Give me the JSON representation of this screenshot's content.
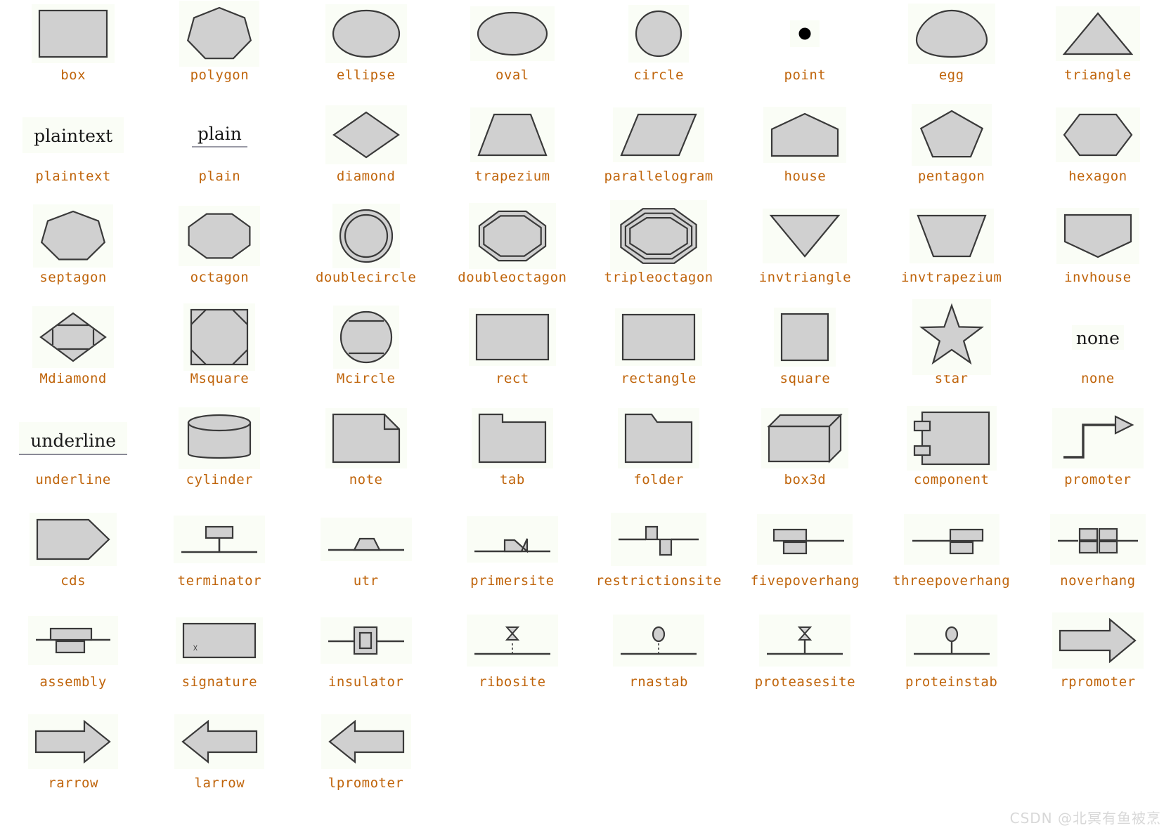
{
  "page": {
    "title": "Graphviz node shapes gallery",
    "watermark": "CSDN @北冥有鱼被烹",
    "label_color": "#c0650c",
    "shape_fill": "#d0d0d0",
    "shape_stroke": "#3a3a3a",
    "cell_background": "#fafdf6",
    "page_background": "#ffffff"
  },
  "shapes": [
    {
      "label": "box",
      "kind": "box"
    },
    {
      "label": "polygon",
      "kind": "polygon"
    },
    {
      "label": "ellipse",
      "kind": "ellipse"
    },
    {
      "label": "oval",
      "kind": "oval"
    },
    {
      "label": "circle",
      "kind": "circle"
    },
    {
      "label": "point",
      "kind": "point"
    },
    {
      "label": "egg",
      "kind": "egg"
    },
    {
      "label": "triangle",
      "kind": "triangle"
    },
    {
      "label": "plaintext",
      "kind": "text",
      "text": "plaintext"
    },
    {
      "label": "plain",
      "kind": "text-ul",
      "text": "plain"
    },
    {
      "label": "diamond",
      "kind": "diamond"
    },
    {
      "label": "trapezium",
      "kind": "trapezium"
    },
    {
      "label": "parallelogram",
      "kind": "parallelogram"
    },
    {
      "label": "house",
      "kind": "house"
    },
    {
      "label": "pentagon",
      "kind": "pentagon"
    },
    {
      "label": "hexagon",
      "kind": "hexagon"
    },
    {
      "label": "septagon",
      "kind": "septagon"
    },
    {
      "label": "octagon",
      "kind": "octagon"
    },
    {
      "label": "doublecircle",
      "kind": "doublecircle"
    },
    {
      "label": "doubleoctagon",
      "kind": "doubleoctagon"
    },
    {
      "label": "tripleoctagon",
      "kind": "tripleoctagon"
    },
    {
      "label": "invtriangle",
      "kind": "invtriangle"
    },
    {
      "label": "invtrapezium",
      "kind": "invtrapezium"
    },
    {
      "label": "invhouse",
      "kind": "invhouse"
    },
    {
      "label": "Mdiamond",
      "kind": "mdiamond"
    },
    {
      "label": "Msquare",
      "kind": "msquare"
    },
    {
      "label": "Mcircle",
      "kind": "mcircle"
    },
    {
      "label": "rect",
      "kind": "rect"
    },
    {
      "label": "rectangle",
      "kind": "rectangle"
    },
    {
      "label": "square",
      "kind": "square"
    },
    {
      "label": "star",
      "kind": "star"
    },
    {
      "label": "none",
      "kind": "text-none",
      "text": "none"
    },
    {
      "label": "underline",
      "kind": "text-underline",
      "text": "underline"
    },
    {
      "label": "cylinder",
      "kind": "cylinder"
    },
    {
      "label": "note",
      "kind": "note"
    },
    {
      "label": "tab",
      "kind": "tab"
    },
    {
      "label": "folder",
      "kind": "folder"
    },
    {
      "label": "box3d",
      "kind": "box3d"
    },
    {
      "label": "component",
      "kind": "component"
    },
    {
      "label": "promoter",
      "kind": "promoter"
    },
    {
      "label": "cds",
      "kind": "cds"
    },
    {
      "label": "terminator",
      "kind": "terminator"
    },
    {
      "label": "utr",
      "kind": "utr"
    },
    {
      "label": "primersite",
      "kind": "primersite"
    },
    {
      "label": "restrictionsite",
      "kind": "restrictionsite"
    },
    {
      "label": "fivepoverhang",
      "kind": "fivepoverhang"
    },
    {
      "label": "threepoverhang",
      "kind": "threepoverhang"
    },
    {
      "label": "noverhang",
      "kind": "noverhang"
    },
    {
      "label": "assembly",
      "kind": "assembly"
    },
    {
      "label": "signature",
      "kind": "signature"
    },
    {
      "label": "insulator",
      "kind": "insulator"
    },
    {
      "label": "ribosite",
      "kind": "ribosite"
    },
    {
      "label": "rnastab",
      "kind": "rnastab"
    },
    {
      "label": "proteasesite",
      "kind": "proteasesite"
    },
    {
      "label": "proteinstab",
      "kind": "proteinstab"
    },
    {
      "label": "rpromoter",
      "kind": "rpromoter"
    },
    {
      "label": "rarrow",
      "kind": "rarrow"
    },
    {
      "label": "larrow",
      "kind": "larrow"
    },
    {
      "label": "lpromoter",
      "kind": "lpromoter"
    }
  ]
}
